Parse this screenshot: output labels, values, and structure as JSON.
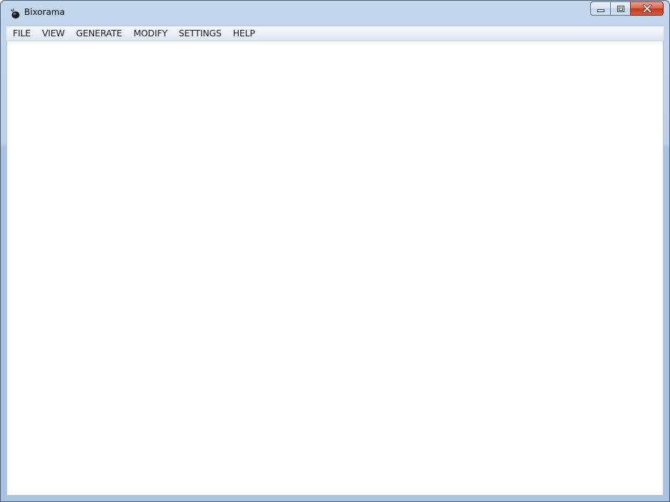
{
  "window": {
    "title": "Bixorama",
    "app_icon": "bixorama-app-icon",
    "buttons": {
      "minimize_icon": "minimize-icon",
      "maximize_icon": "maximize-icon",
      "close_icon": "close-icon"
    }
  },
  "menubar": {
    "items": [
      {
        "label": "FILE"
      },
      {
        "label": "VIEW"
      },
      {
        "label": "GENERATE"
      },
      {
        "label": "MODIFY"
      },
      {
        "label": "SETTINGS"
      },
      {
        "label": "HELP"
      }
    ]
  },
  "colors": {
    "frame": "#bcd1ea",
    "close_button": "#c6391e",
    "client_background": "#ffffff"
  }
}
